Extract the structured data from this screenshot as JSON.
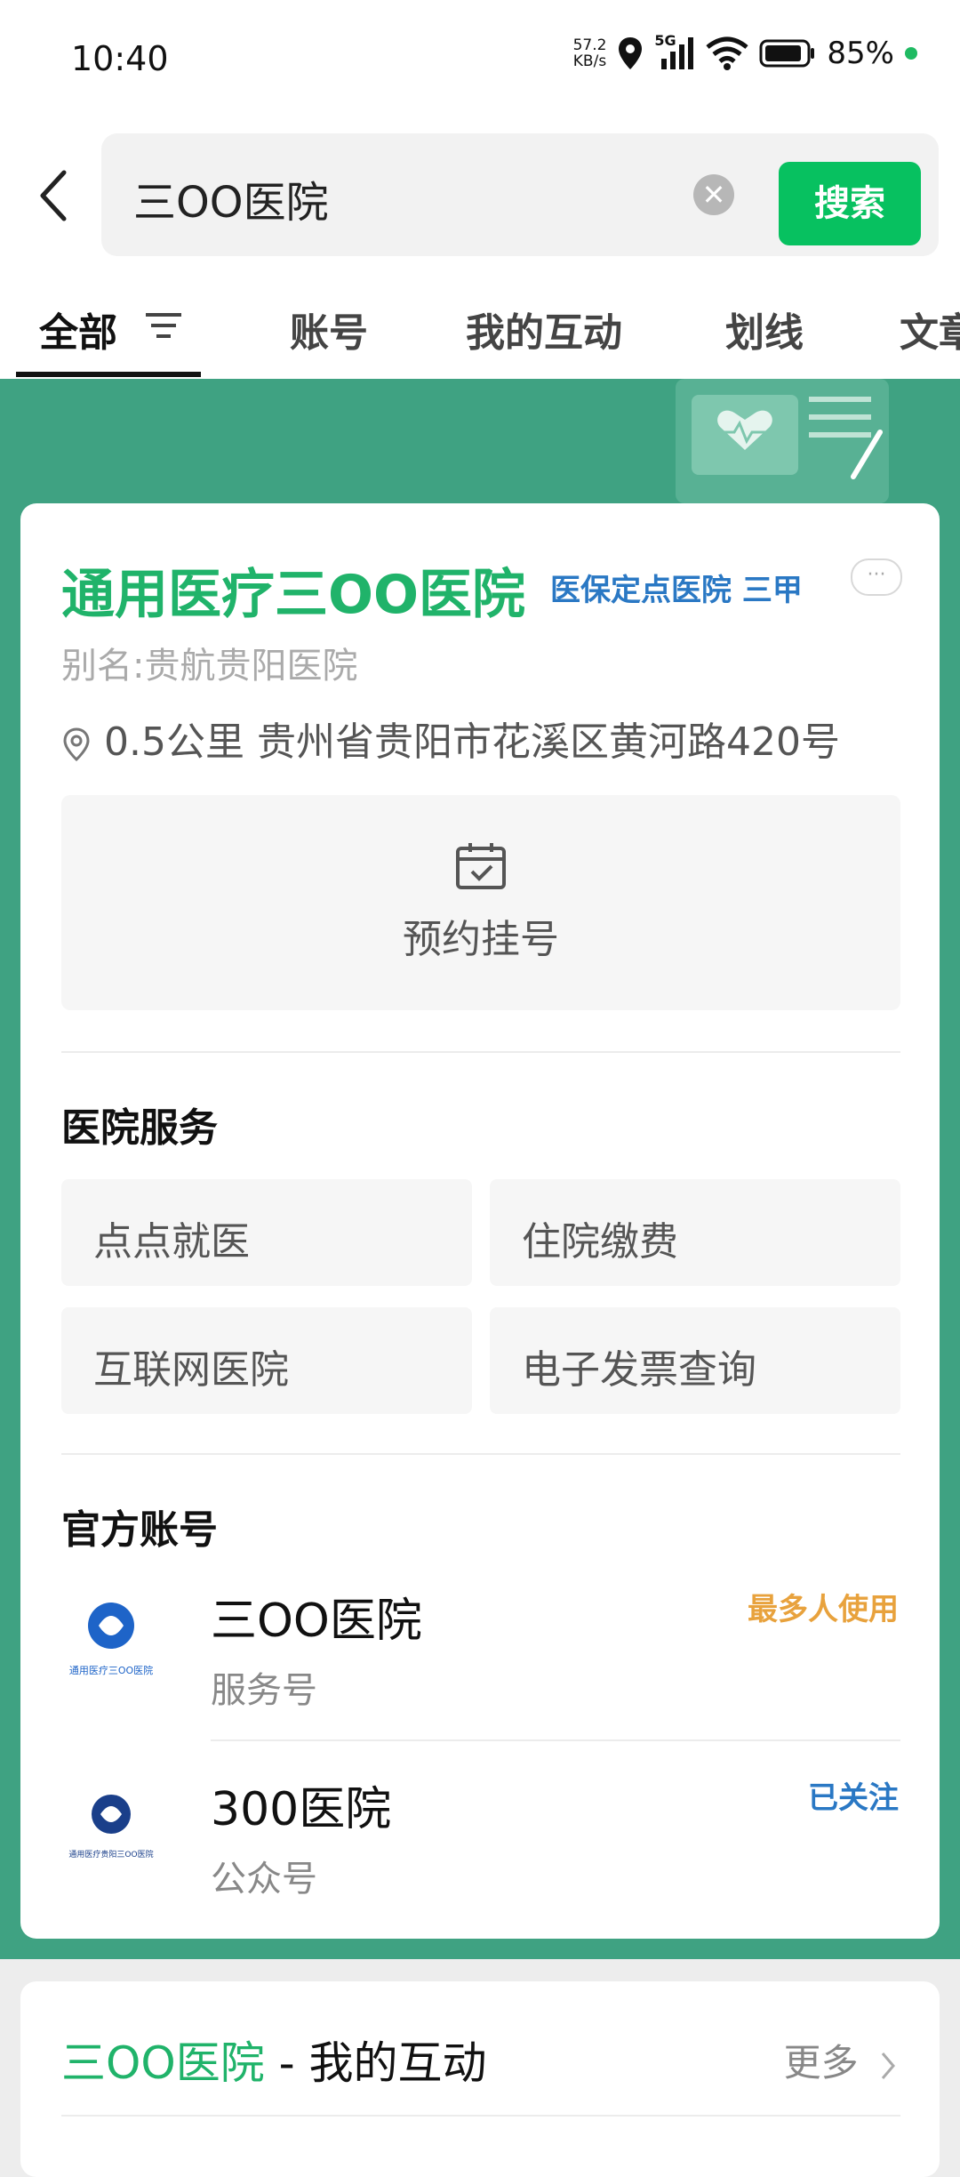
{
  "status_bar": {
    "time": "10:40",
    "net_speed_value": "57.2",
    "net_speed_unit": "KB/s",
    "network": "5G",
    "battery": "85%",
    "icons": [
      "location-icon",
      "signal-icon",
      "wifi-icon",
      "battery-icon"
    ]
  },
  "search": {
    "query": "三OO医院",
    "button": "搜索"
  },
  "tabs": [
    {
      "label": "全部"
    },
    {
      "label": "账号"
    },
    {
      "label": "我的互动"
    },
    {
      "label": "划线"
    },
    {
      "label": "文章"
    }
  ],
  "hospital": {
    "name": "通用医疗三OO医院",
    "tags": "医保定点医院  三甲",
    "more": "···",
    "alias": "别名:贵航贵阳医院",
    "distance": "0.5公里",
    "address": "贵州省贵阳市花溪区黄河路420号",
    "appointment": "预约挂号"
  },
  "services": {
    "title": "医院服务",
    "items": [
      "点点就医",
      "住院缴费",
      "互联网医院",
      "电子发票查询"
    ]
  },
  "official_accounts": {
    "title": "官方账号",
    "items": [
      {
        "name": "三OO医院",
        "type": "服务号",
        "badge": "最多人使用",
        "badge_color": "#e8a23d",
        "logo_text": "通用医疗三OO医院"
      },
      {
        "name": "300医院",
        "type": "公众号",
        "badge": "已关注",
        "badge_color": "#2a78c4",
        "logo_text": "通用医疗贵阳三OO医院"
      }
    ]
  },
  "interaction": {
    "title_green": "三OO医院",
    "title_rest": " - 我的互动",
    "more": "更多"
  },
  "colors": {
    "brand_green": "#07c160",
    "banner_green": "#3fa282",
    "tag_blue": "#2a78c4",
    "badge_orange": "#e8a23d"
  }
}
